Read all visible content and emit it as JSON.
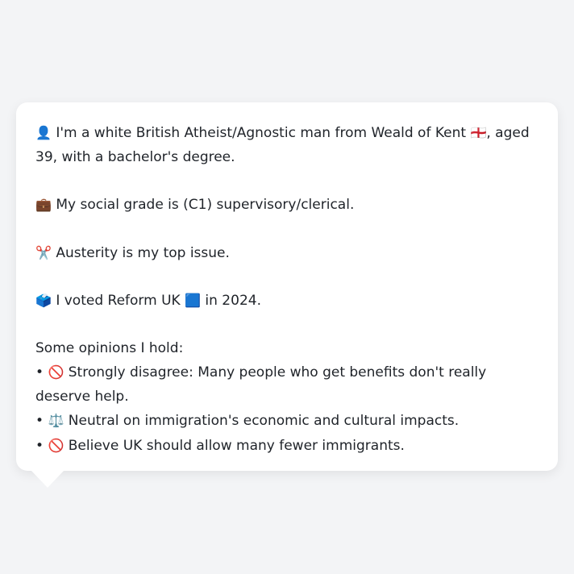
{
  "profile": {
    "intro_icon": "👤",
    "intro_text": "I'm a white British Atheist/Agnostic man from Weald of Kent",
    "intro_flag": "🏴󠁧󠁢󠁥󠁮󠁧󠁿",
    "intro_rest": ", aged 39, with a bachelor's degree.",
    "grade_icon": "💼",
    "grade_text": "My social grade is (C1) supervisory/clerical.",
    "issue_icon": "✂️",
    "issue_text": "Austerity is my top issue.",
    "vote_icon": "🗳️",
    "vote_text_before": "I voted Reform UK",
    "vote_party_icon": "🟦",
    "vote_text_after": "in 2024."
  },
  "opinions": {
    "heading": "Some opinions I hold:",
    "items": [
      {
        "bullet": "•",
        "icon": "🚫",
        "text": "Strongly disagree: Many people who get benefits don't really deserve help."
      },
      {
        "bullet": "•",
        "icon": "⚖️",
        "text": "Neutral on immigration's economic and cultural impacts."
      },
      {
        "bullet": "•",
        "icon": "🚫",
        "text": "Believe UK should allow many fewer immigrants."
      }
    ]
  }
}
